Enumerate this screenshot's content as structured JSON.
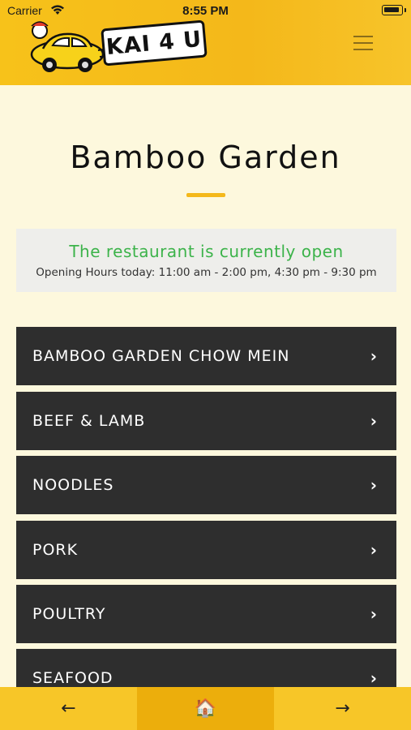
{
  "status_bar": {
    "carrier": "Carrier",
    "time": "8:55 PM"
  },
  "header": {
    "logo_text": "KAI 4 U",
    "menu_icon": "hamburger-menu-icon"
  },
  "restaurant": {
    "name": "Bamboo Garden",
    "status": "The restaurant is currently open",
    "hours": "Opening Hours today: 11:00 am - 2:00 pm, 4:30 pm - 9:30 pm"
  },
  "categories": [
    {
      "label": "BAMBOO GARDEN CHOW MEIN"
    },
    {
      "label": "BEEF & LAMB"
    },
    {
      "label": "NOODLES"
    },
    {
      "label": "PORK"
    },
    {
      "label": "POULTRY"
    },
    {
      "label": "SEAFOOD"
    }
  ],
  "chevron": "›",
  "bottom_nav": {
    "back": "←",
    "home": "🏠",
    "forward": "→"
  },
  "colors": {
    "header": "#f4b81a",
    "background": "#fdf8dd",
    "category_bg": "#2e2e2e",
    "open_green": "#3cb34a"
  }
}
